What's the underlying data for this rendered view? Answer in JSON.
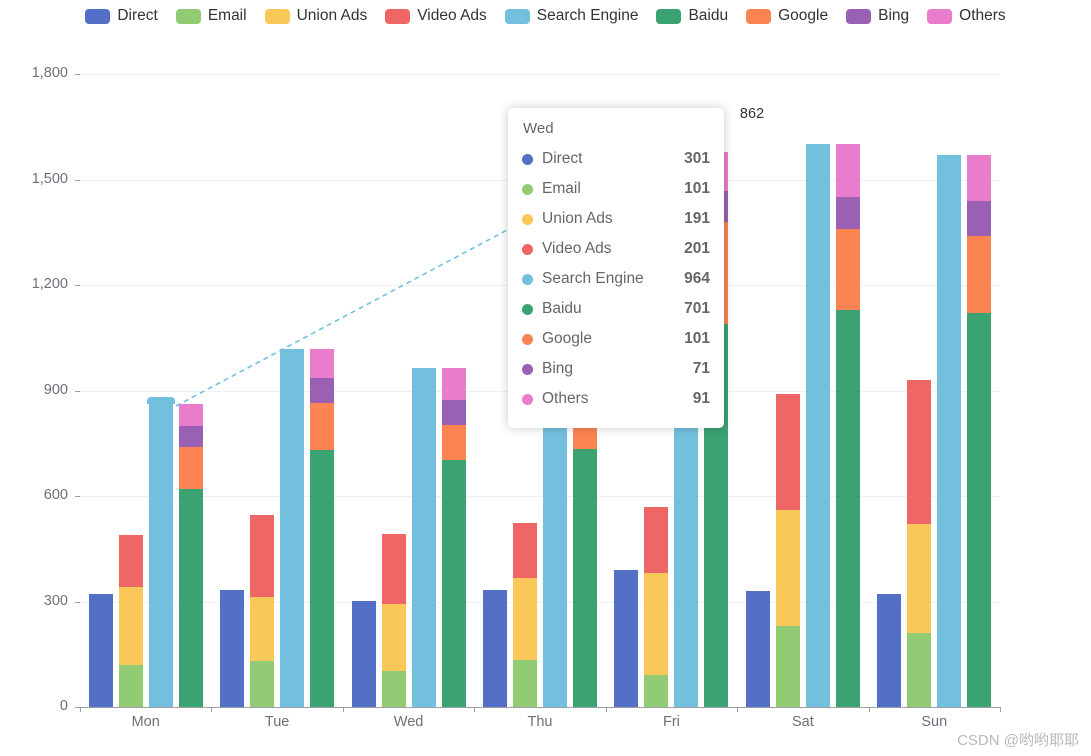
{
  "legend": {
    "items": [
      {
        "label": "Direct",
        "color": "#5470c6"
      },
      {
        "label": "Email",
        "color": "#91cc75"
      },
      {
        "label": "Union Ads",
        "color": "#fac858"
      },
      {
        "label": "Video Ads",
        "color": "#ee6666"
      },
      {
        "label": "Search Engine",
        "color": "#73c0de"
      },
      {
        "label": "Baidu",
        "color": "#3ba272"
      },
      {
        "label": "Google",
        "color": "#fc8452"
      },
      {
        "label": "Bing",
        "color": "#9a60b4"
      },
      {
        "label": "Others",
        "color": "#ea7ccc"
      }
    ]
  },
  "tooltip": {
    "title": "Wed",
    "rows": [
      {
        "name": "Direct",
        "value": "301",
        "color": "#5470c6"
      },
      {
        "name": "Email",
        "value": "101",
        "color": "#91cc75"
      },
      {
        "name": "Union Ads",
        "value": "191",
        "color": "#fac858"
      },
      {
        "name": "Video Ads",
        "value": "201",
        "color": "#ee6666"
      },
      {
        "name": "Search Engine",
        "value": "964",
        "color": "#73c0de"
      },
      {
        "name": "Baidu",
        "value": "701",
        "color": "#3ba272"
      },
      {
        "name": "Google",
        "value": "101",
        "color": "#fc8452"
      },
      {
        "name": "Bing",
        "value": "71",
        "color": "#9a60b4"
      },
      {
        "name": "Others",
        "value": "91",
        "color": "#ea7ccc"
      }
    ]
  },
  "annotation": {
    "value_label": "862"
  },
  "watermark": {
    "text": "CSDN @哟哟耶耶"
  },
  "chart_data": {
    "type": "bar",
    "title": "",
    "xlabel": "",
    "ylabel": "",
    "grid": true,
    "legend_position": "top",
    "stacked_groups": true,
    "categories": [
      "Mon",
      "Tue",
      "Wed",
      "Thu",
      "Fri",
      "Sat",
      "Sun"
    ],
    "ylim": [
      0,
      1800
    ],
    "yticks": [
      0,
      300,
      600,
      900,
      1200,
      1500,
      1800
    ],
    "ytick_labels": [
      "0",
      "300",
      "600",
      "900",
      "1,200",
      "1,500",
      "1,800"
    ],
    "series": [
      {
        "name": "Direct",
        "stack": "Ad",
        "color": "#5470c6",
        "values": [
          320,
          332,
          301,
          334,
          390,
          330,
          320
        ]
      },
      {
        "name": "Email",
        "stack": "Ad",
        "color": "#91cc75",
        "values": [
          120,
          132,
          101,
          134,
          90,
          230,
          210
        ]
      },
      {
        "name": "Union Ads",
        "stack": "Ad",
        "color": "#fac858",
        "values": [
          220,
          182,
          191,
          234,
          290,
          330,
          310
        ]
      },
      {
        "name": "Video Ads",
        "stack": "Ad",
        "color": "#ee6666",
        "values": [
          150,
          232,
          201,
          154,
          190,
          330,
          410
        ]
      },
      {
        "name": "Search Engine",
        "stack": "Search",
        "color": "#73c0de",
        "values": [
          862,
          1018,
          964,
          1026,
          1679,
          1600,
          1570
        ]
      },
      {
        "name": "Baidu",
        "stack": "Engine",
        "color": "#3ba272",
        "values": [
          620,
          732,
          701,
          734,
          1090,
          1130,
          1120
        ]
      },
      {
        "name": "Google",
        "stack": "Engine",
        "color": "#fc8452",
        "values": [
          120,
          132,
          101,
          134,
          290,
          230,
          220
        ]
      },
      {
        "name": "Bing",
        "stack": "Engine",
        "color": "#9a60b4",
        "values": [
          60,
          72,
          71,
          74,
          88,
          90,
          100
        ]
      },
      {
        "name": "Others",
        "stack": "Engine",
        "color": "#ea7ccc",
        "values": [
          62,
          82,
          91,
          84,
          109,
          150,
          130
        ]
      }
    ],
    "annotations": [
      {
        "series": "Search Engine",
        "category": "Fri",
        "label": "862",
        "x": 752,
        "y": 115
      }
    ]
  },
  "axis": {
    "x_labels": [
      "Mon",
      "Tue",
      "Wed",
      "Thu",
      "Fri",
      "Sat",
      "Sun"
    ],
    "y_labels": [
      "1,800",
      "1,500",
      "1,200",
      "900",
      "600",
      "300",
      "0"
    ]
  }
}
